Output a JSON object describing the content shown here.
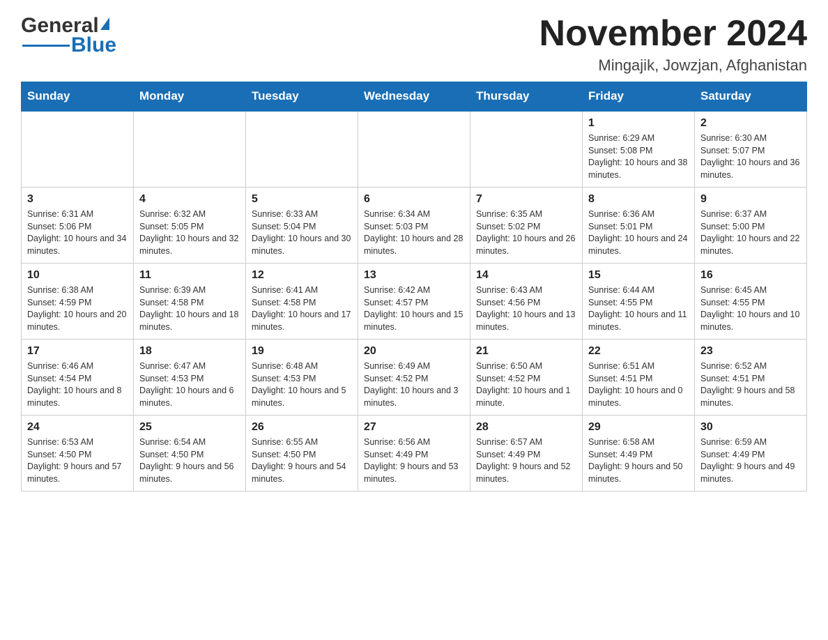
{
  "header": {
    "logo": {
      "general": "General",
      "blue": "Blue",
      "arrow_unicode": "▶"
    },
    "title": "November 2024",
    "subtitle": "Mingajik, Jowzjan, Afghanistan"
  },
  "calendar": {
    "days_of_week": [
      "Sunday",
      "Monday",
      "Tuesday",
      "Wednesday",
      "Thursday",
      "Friday",
      "Saturday"
    ],
    "weeks": [
      [
        {
          "day": "",
          "sunrise": "",
          "sunset": "",
          "daylight": ""
        },
        {
          "day": "",
          "sunrise": "",
          "sunset": "",
          "daylight": ""
        },
        {
          "day": "",
          "sunrise": "",
          "sunset": "",
          "daylight": ""
        },
        {
          "day": "",
          "sunrise": "",
          "sunset": "",
          "daylight": ""
        },
        {
          "day": "",
          "sunrise": "",
          "sunset": "",
          "daylight": ""
        },
        {
          "day": "1",
          "sunrise": "Sunrise: 6:29 AM",
          "sunset": "Sunset: 5:08 PM",
          "daylight": "Daylight: 10 hours and 38 minutes."
        },
        {
          "day": "2",
          "sunrise": "Sunrise: 6:30 AM",
          "sunset": "Sunset: 5:07 PM",
          "daylight": "Daylight: 10 hours and 36 minutes."
        }
      ],
      [
        {
          "day": "3",
          "sunrise": "Sunrise: 6:31 AM",
          "sunset": "Sunset: 5:06 PM",
          "daylight": "Daylight: 10 hours and 34 minutes."
        },
        {
          "day": "4",
          "sunrise": "Sunrise: 6:32 AM",
          "sunset": "Sunset: 5:05 PM",
          "daylight": "Daylight: 10 hours and 32 minutes."
        },
        {
          "day": "5",
          "sunrise": "Sunrise: 6:33 AM",
          "sunset": "Sunset: 5:04 PM",
          "daylight": "Daylight: 10 hours and 30 minutes."
        },
        {
          "day": "6",
          "sunrise": "Sunrise: 6:34 AM",
          "sunset": "Sunset: 5:03 PM",
          "daylight": "Daylight: 10 hours and 28 minutes."
        },
        {
          "day": "7",
          "sunrise": "Sunrise: 6:35 AM",
          "sunset": "Sunset: 5:02 PM",
          "daylight": "Daylight: 10 hours and 26 minutes."
        },
        {
          "day": "8",
          "sunrise": "Sunrise: 6:36 AM",
          "sunset": "Sunset: 5:01 PM",
          "daylight": "Daylight: 10 hours and 24 minutes."
        },
        {
          "day": "9",
          "sunrise": "Sunrise: 6:37 AM",
          "sunset": "Sunset: 5:00 PM",
          "daylight": "Daylight: 10 hours and 22 minutes."
        }
      ],
      [
        {
          "day": "10",
          "sunrise": "Sunrise: 6:38 AM",
          "sunset": "Sunset: 4:59 PM",
          "daylight": "Daylight: 10 hours and 20 minutes."
        },
        {
          "day": "11",
          "sunrise": "Sunrise: 6:39 AM",
          "sunset": "Sunset: 4:58 PM",
          "daylight": "Daylight: 10 hours and 18 minutes."
        },
        {
          "day": "12",
          "sunrise": "Sunrise: 6:41 AM",
          "sunset": "Sunset: 4:58 PM",
          "daylight": "Daylight: 10 hours and 17 minutes."
        },
        {
          "day": "13",
          "sunrise": "Sunrise: 6:42 AM",
          "sunset": "Sunset: 4:57 PM",
          "daylight": "Daylight: 10 hours and 15 minutes."
        },
        {
          "day": "14",
          "sunrise": "Sunrise: 6:43 AM",
          "sunset": "Sunset: 4:56 PM",
          "daylight": "Daylight: 10 hours and 13 minutes."
        },
        {
          "day": "15",
          "sunrise": "Sunrise: 6:44 AM",
          "sunset": "Sunset: 4:55 PM",
          "daylight": "Daylight: 10 hours and 11 minutes."
        },
        {
          "day": "16",
          "sunrise": "Sunrise: 6:45 AM",
          "sunset": "Sunset: 4:55 PM",
          "daylight": "Daylight: 10 hours and 10 minutes."
        }
      ],
      [
        {
          "day": "17",
          "sunrise": "Sunrise: 6:46 AM",
          "sunset": "Sunset: 4:54 PM",
          "daylight": "Daylight: 10 hours and 8 minutes."
        },
        {
          "day": "18",
          "sunrise": "Sunrise: 6:47 AM",
          "sunset": "Sunset: 4:53 PM",
          "daylight": "Daylight: 10 hours and 6 minutes."
        },
        {
          "day": "19",
          "sunrise": "Sunrise: 6:48 AM",
          "sunset": "Sunset: 4:53 PM",
          "daylight": "Daylight: 10 hours and 5 minutes."
        },
        {
          "day": "20",
          "sunrise": "Sunrise: 6:49 AM",
          "sunset": "Sunset: 4:52 PM",
          "daylight": "Daylight: 10 hours and 3 minutes."
        },
        {
          "day": "21",
          "sunrise": "Sunrise: 6:50 AM",
          "sunset": "Sunset: 4:52 PM",
          "daylight": "Daylight: 10 hours and 1 minute."
        },
        {
          "day": "22",
          "sunrise": "Sunrise: 6:51 AM",
          "sunset": "Sunset: 4:51 PM",
          "daylight": "Daylight: 10 hours and 0 minutes."
        },
        {
          "day": "23",
          "sunrise": "Sunrise: 6:52 AM",
          "sunset": "Sunset: 4:51 PM",
          "daylight": "Daylight: 9 hours and 58 minutes."
        }
      ],
      [
        {
          "day": "24",
          "sunrise": "Sunrise: 6:53 AM",
          "sunset": "Sunset: 4:50 PM",
          "daylight": "Daylight: 9 hours and 57 minutes."
        },
        {
          "day": "25",
          "sunrise": "Sunrise: 6:54 AM",
          "sunset": "Sunset: 4:50 PM",
          "daylight": "Daylight: 9 hours and 56 minutes."
        },
        {
          "day": "26",
          "sunrise": "Sunrise: 6:55 AM",
          "sunset": "Sunset: 4:50 PM",
          "daylight": "Daylight: 9 hours and 54 minutes."
        },
        {
          "day": "27",
          "sunrise": "Sunrise: 6:56 AM",
          "sunset": "Sunset: 4:49 PM",
          "daylight": "Daylight: 9 hours and 53 minutes."
        },
        {
          "day": "28",
          "sunrise": "Sunrise: 6:57 AM",
          "sunset": "Sunset: 4:49 PM",
          "daylight": "Daylight: 9 hours and 52 minutes."
        },
        {
          "day": "29",
          "sunrise": "Sunrise: 6:58 AM",
          "sunset": "Sunset: 4:49 PM",
          "daylight": "Daylight: 9 hours and 50 minutes."
        },
        {
          "day": "30",
          "sunrise": "Sunrise: 6:59 AM",
          "sunset": "Sunset: 4:49 PM",
          "daylight": "Daylight: 9 hours and 49 minutes."
        }
      ]
    ]
  }
}
